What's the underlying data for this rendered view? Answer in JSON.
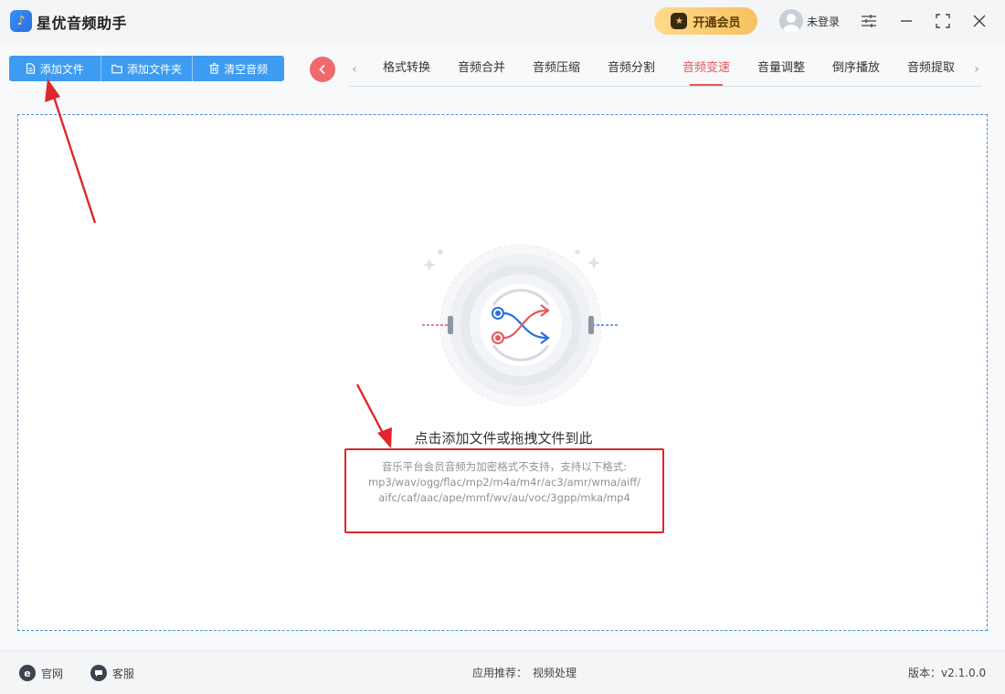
{
  "app": {
    "title": "星优音频助手",
    "logo_icon": "music-note-icon"
  },
  "header": {
    "vip_label": "开通会员",
    "login_label": "未登录",
    "accent_color": "#f7c15e"
  },
  "toolbar": {
    "buttons": [
      {
        "label": "添加文件",
        "icon": "file-icon"
      },
      {
        "label": "添加文件夹",
        "icon": "folder-icon"
      },
      {
        "label": "清空音频",
        "icon": "trash-icon"
      }
    ],
    "button_color": "#3d9bf1"
  },
  "tabs": {
    "items": [
      {
        "label": "格式转换"
      },
      {
        "label": "音频合并"
      },
      {
        "label": "音频压缩"
      },
      {
        "label": "音频分割"
      },
      {
        "label": "音频变速"
      },
      {
        "label": "音量调整"
      },
      {
        "label": "倒序播放"
      },
      {
        "label": "音频提取"
      }
    ],
    "active": "音频变速",
    "active_color": "#e4585c"
  },
  "dropzone": {
    "title": "点击添加文件或拖拽文件到此",
    "format_lines": [
      "音乐平台会员音频为加密格式不支持，支持以下格式:",
      "mp3/wav/ogg/flac/mp2/m4a/m4r/ac3/amr/wma/aiff/",
      "aifc/caf/aac/ape/mmf/wv/au/voc/3gpp/mka/mp4"
    ],
    "highlight_color": "#e0262a"
  },
  "statusbar": {
    "website_label": "官网",
    "support_label": "客服",
    "recommend_prefix": "应用推荐：",
    "recommend_link": "视频处理",
    "version_prefix": "版本：",
    "version": "v2.1.0.0"
  }
}
